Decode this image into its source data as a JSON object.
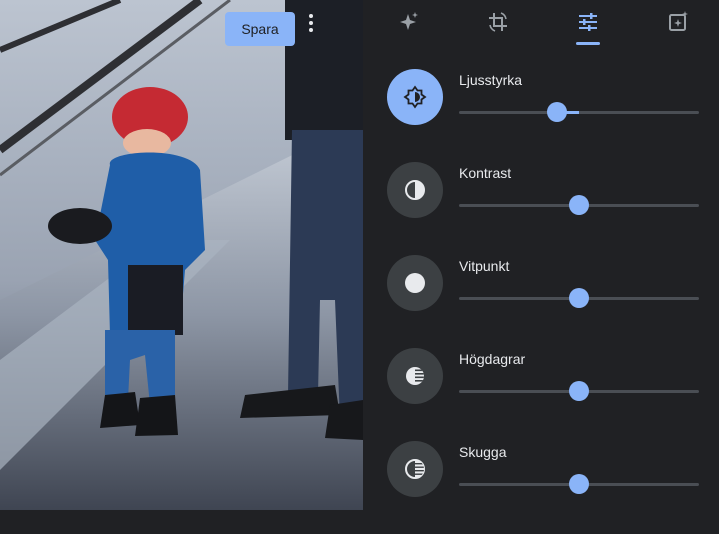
{
  "photo": {
    "save_label": "Spara",
    "more_icon": "more-vert-icon"
  },
  "tabs": [
    {
      "name": "auto-enhance",
      "icon": "sparkle-icon",
      "active": false
    },
    {
      "name": "crop-rotate",
      "icon": "crop-rotate-icon",
      "active": false
    },
    {
      "name": "adjust",
      "icon": "tune-sliders-icon",
      "active": true
    },
    {
      "name": "filters",
      "icon": "filter-sparkle-icon",
      "active": false
    }
  ],
  "adjustments": [
    {
      "label": "Ljusstyrka",
      "icon": "brightness-icon",
      "value": -18,
      "active": true
    },
    {
      "label": "Kontrast",
      "icon": "contrast-icon",
      "value": 0,
      "active": false
    },
    {
      "label": "Vitpunkt",
      "icon": "white-point-icon",
      "value": 0,
      "active": false
    },
    {
      "label": "Högdagrar",
      "icon": "highlights-icon",
      "value": 0,
      "active": false
    },
    {
      "label": "Skugga",
      "icon": "shadows-icon",
      "value": 0,
      "active": false
    }
  ],
  "colors": {
    "accent": "#8ab4f8",
    "panel_bg": "#202124",
    "button_bg": "#3c4043",
    "track": "#4a4e54",
    "text": "#e8eaed"
  }
}
